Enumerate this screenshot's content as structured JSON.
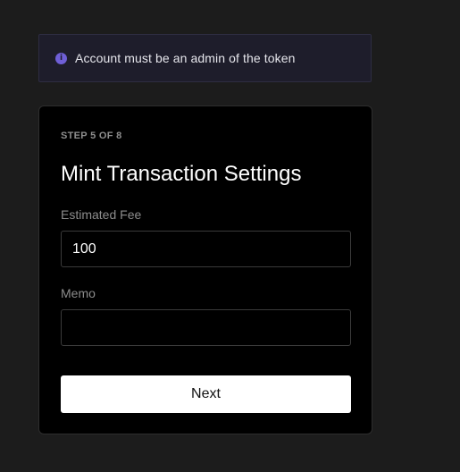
{
  "notice": {
    "icon": "info-icon",
    "icon_glyph": "i",
    "text": "Account must be an admin of the token",
    "accent_color": "#6f5fd6"
  },
  "form": {
    "step": "STEP 5 OF 8",
    "title": "Mint Transaction Settings",
    "fee": {
      "label": "Estimated Fee",
      "value": "100"
    },
    "memo": {
      "label": "Memo",
      "value": ""
    },
    "next_label": "Next"
  }
}
